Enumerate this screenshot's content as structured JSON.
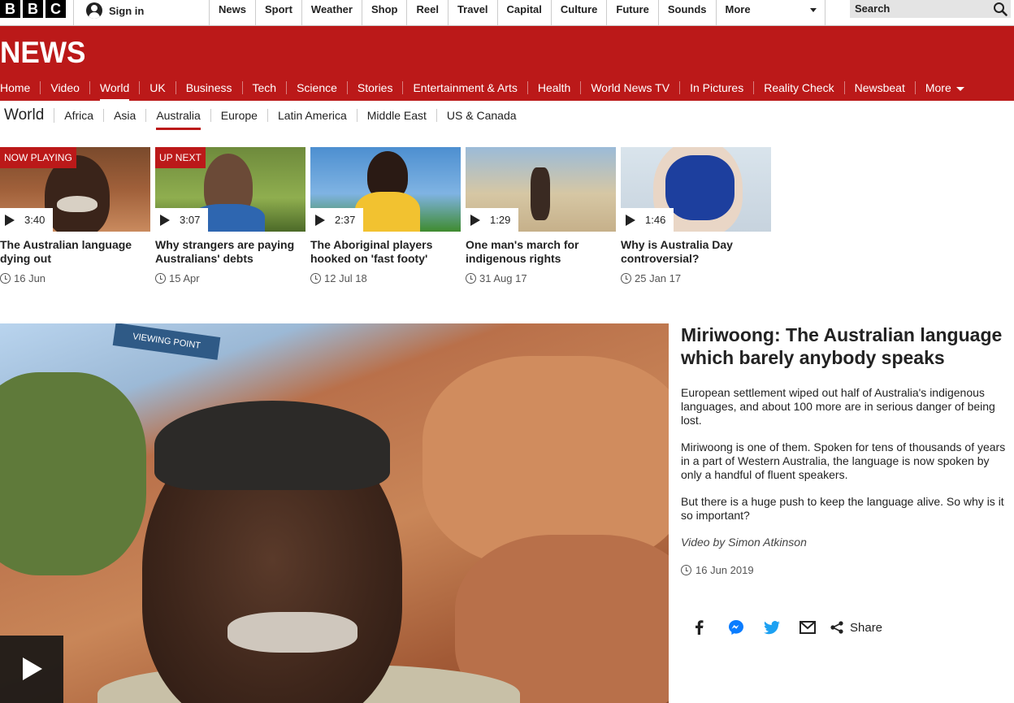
{
  "top": {
    "brand": [
      "B",
      "B",
      "C"
    ],
    "signin": "Sign in",
    "nav": [
      "News",
      "Sport",
      "Weather",
      "Shop",
      "Reel",
      "Travel",
      "Capital",
      "Culture",
      "Future",
      "Sounds",
      "More"
    ],
    "search_placeholder": "Search"
  },
  "news": {
    "logo": "NEWS",
    "nav": [
      "Home",
      "Video",
      "World",
      "UK",
      "Business",
      "Tech",
      "Science",
      "Stories",
      "Entertainment & Arts",
      "Health",
      "World News TV",
      "In Pictures",
      "Reality Check",
      "Newsbeat",
      "More"
    ],
    "active": "World"
  },
  "section": {
    "title": "World",
    "nav": [
      "Africa",
      "Asia",
      "Australia",
      "Europe",
      "Latin America",
      "Middle East",
      "US & Canada"
    ],
    "active": "Australia"
  },
  "videos": [
    {
      "badge": "NOW PLAYING",
      "duration": "3:40",
      "title": "The Australian language dying out",
      "date": "16 Jun"
    },
    {
      "badge": "UP NEXT",
      "duration": "3:07",
      "title": "Why strangers are paying Australians' debts",
      "date": "15 Apr"
    },
    {
      "badge": "",
      "duration": "2:37",
      "title": "The Aboriginal players hooked on 'fast footy'",
      "date": "12 Jul 18"
    },
    {
      "badge": "",
      "duration": "1:29",
      "title": "One man's march for indigenous rights",
      "date": "31 Aug 17"
    },
    {
      "badge": "",
      "duration": "1:46",
      "title": "Why is Australia Day controversial?",
      "date": "25 Jan 17"
    }
  ],
  "story": {
    "headline": "Miriwoong: The Australian language which barely anybody speaks",
    "paragraphs": [
      "European settlement wiped out half of Australia's indigenous languages, and about 100 more are in serious danger of being lost.",
      "Miriwoong is one of them. Spoken for tens of thousands of years in a part of Western Australia, the language is now spoken by only a handful of fluent speakers.",
      "But there is a huge push to keep the language alive. So why is it so important?"
    ],
    "byline": "Video by Simon Atkinson",
    "date": "16 Jun 2019",
    "share_label": "Share",
    "hero_sign": "VIEWING POINT"
  },
  "colors": {
    "brand_red": "#bb1919",
    "text": "#222222"
  }
}
